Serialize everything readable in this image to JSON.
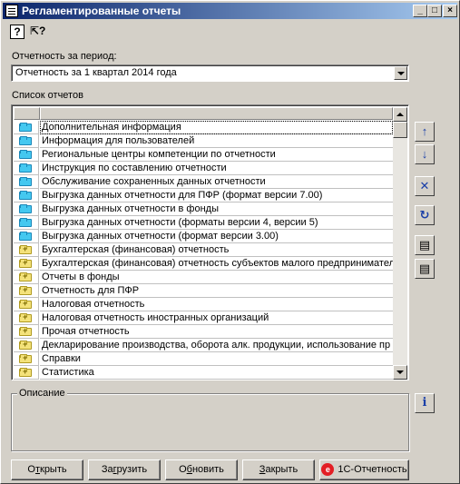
{
  "window": {
    "title": "Регламентированные отчеты",
    "controls": {
      "minimize": "_",
      "maximize": "□",
      "close": "×"
    }
  },
  "toolbar": {
    "help_icon": "?",
    "whatsthis_icon": "⇱?"
  },
  "period": {
    "label": "Отчетность за период:",
    "value": "Отчетность за 1 квартал 2014 года"
  },
  "reports": {
    "label": "Список отчетов",
    "items": [
      {
        "label": "Дополнительная информация",
        "icon": "folder-cyan",
        "selected": true
      },
      {
        "label": "Информация для пользователей",
        "icon": "folder-cyan"
      },
      {
        "label": "Региональные центры компетенции по отчетности",
        "icon": "folder-cyan"
      },
      {
        "label": "Инструкция по составлению отчетности",
        "icon": "folder-cyan"
      },
      {
        "label": "Обслуживание сохраненных данных отчетности",
        "icon": "folder-cyan"
      },
      {
        "label": "Выгрузка данных отчетности для ПФР (формат версии 7.00)",
        "icon": "folder-cyan"
      },
      {
        "label": "Выгрузка данных отчетности в фонды",
        "icon": "folder-cyan"
      },
      {
        "label": "Выгрузка данных отчетности (форматы версии 4, версии 5)",
        "icon": "folder-cyan"
      },
      {
        "label": "Выгрузка данных отчетности (формат версии 3.00)",
        "icon": "folder-cyan"
      },
      {
        "label": "Бухгалтерская (финансовая) отчетность",
        "icon": "folder-yellow-plus"
      },
      {
        "label": "Бухгалтерская (финансовая) отчетность субъектов малого предпринимател",
        "icon": "folder-yellow-plus"
      },
      {
        "label": "Отчеты в фонды",
        "icon": "folder-yellow-plus"
      },
      {
        "label": "Отчетность для ПФР",
        "icon": "folder-yellow-plus"
      },
      {
        "label": "Налоговая отчетность",
        "icon": "folder-yellow-plus"
      },
      {
        "label": "Налоговая отчетность иностранных организаций",
        "icon": "folder-yellow-plus"
      },
      {
        "label": "Прочая отчетность",
        "icon": "folder-yellow-plus"
      },
      {
        "label": "Декларирование производства, оборота алк. продукции, использование пр",
        "icon": "folder-yellow-plus"
      },
      {
        "label": "Справки",
        "icon": "folder-yellow-plus"
      },
      {
        "label": "Статистика",
        "icon": "folder-yellow-plus"
      }
    ]
  },
  "side_buttons": {
    "move_up": "↑",
    "move_down": "↓",
    "delete": "✕",
    "refresh": "↻",
    "restore_1": "▤",
    "restore_2": "▤",
    "info": "i"
  },
  "description": {
    "label": "Описание"
  },
  "buttons": {
    "open": {
      "ul": "т",
      "pre": "О",
      "post": "крыть"
    },
    "load": {
      "ul": "г",
      "pre": "За",
      "post": "рузить"
    },
    "update": {
      "ul": "б",
      "pre": "О",
      "post": "новить"
    },
    "close": {
      "ul": "З",
      "pre": "",
      "post": "акрыть"
    },
    "onec": {
      "badge": "e",
      "label": "1С-Отчетность"
    }
  },
  "colors": {
    "title_start": "#0a246a",
    "title_end": "#a6caf0",
    "face": "#d4d0c8",
    "folder_cyan": "#44c8f0",
    "folder_yellow": "#f4e27a",
    "side_icon": "#1a3fa8",
    "onec_badge": "#e31e24"
  }
}
